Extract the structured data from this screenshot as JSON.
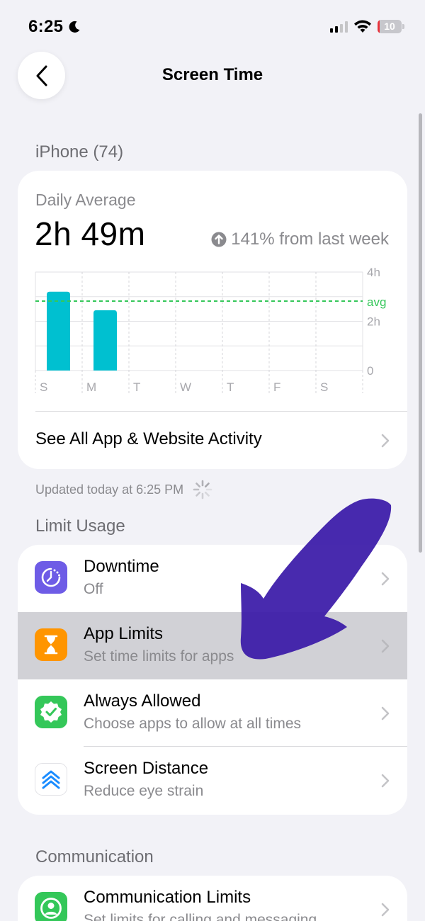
{
  "status_bar": {
    "time": "6:25",
    "battery": "10",
    "battery_level": 0.1
  },
  "nav": {
    "title": "Screen Time",
    "back_icon": "chevron-left-icon"
  },
  "device_section": {
    "header": "iPhone (74)"
  },
  "daily_average": {
    "label": "Daily Average",
    "value": "2h 49m",
    "trend_text": "141% from last week",
    "trend_icon": "arrow-up-circle-icon"
  },
  "chart_data": {
    "type": "bar",
    "categories": [
      "S",
      "M",
      "T",
      "W",
      "T",
      "F",
      "S"
    ],
    "values": [
      3.2,
      2.45,
      0,
      0,
      0,
      0,
      0
    ],
    "average": 2.82,
    "y_ticks": [
      "0",
      "2h",
      "4h"
    ],
    "avg_label": "avg",
    "ylim": [
      0,
      4
    ],
    "bar_color": "#00c0d0",
    "avg_color": "#34c759"
  },
  "activity_link": {
    "label": "See All App & Website Activity"
  },
  "updated": {
    "text": "Updated today at 6:25 PM"
  },
  "limit_usage": {
    "header": "Limit Usage",
    "items": [
      {
        "title": "Downtime",
        "subtitle": "Off",
        "icon": "downtime-icon",
        "color": "#6e5ce6"
      },
      {
        "title": "App Limits",
        "subtitle": "Set time limits for apps",
        "icon": "hourglass-icon",
        "color": "#ff9500"
      },
      {
        "title": "Always Allowed",
        "subtitle": "Choose apps to allow at all times",
        "icon": "checkmark-seal-icon",
        "color": "#34c759"
      },
      {
        "title": "Screen Distance",
        "subtitle": "Reduce eye strain",
        "icon": "screen-distance-icon",
        "color": "#ffffff"
      }
    ]
  },
  "communication": {
    "header": "Communication",
    "items": [
      {
        "title": "Communication Limits",
        "subtitle": "Set limits for calling and messaging",
        "icon": "person-circle-icon",
        "color": "#34c759"
      }
    ]
  },
  "overlay": {
    "icon": "annotation-arrow-icon",
    "color": "#3a1aa8"
  }
}
